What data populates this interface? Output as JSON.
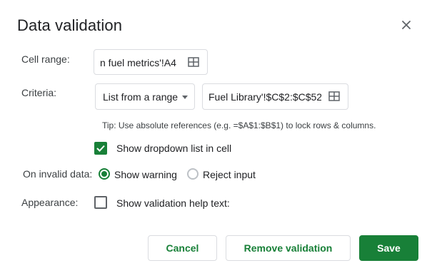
{
  "dialog": {
    "title": "Data validation",
    "close_icon": "close-icon"
  },
  "cell_range": {
    "label": "Cell range:",
    "value": "n fuel metrics'!A4",
    "icon": "grid-icon"
  },
  "criteria": {
    "label": "Criteria:",
    "dropdown_value": "List from a range",
    "range_value": "Fuel Library'!$C$2:$C$52",
    "icon": "grid-icon",
    "tip": "Tip: Use absolute references (e.g. =$A$1:$B$1) to lock rows & columns."
  },
  "show_dropdown": {
    "label": "Show dropdown list in cell",
    "checked": true
  },
  "invalid_data": {
    "label": "On invalid data:",
    "options": [
      {
        "label": "Show warning",
        "selected": true
      },
      {
        "label": "Reject input",
        "selected": false
      }
    ]
  },
  "appearance": {
    "label": "Appearance:",
    "help_text_label": "Show validation help text:",
    "checked": false
  },
  "buttons": {
    "cancel": "Cancel",
    "remove": "Remove validation",
    "save": "Save"
  },
  "colors": {
    "accent": "#188038",
    "border": "#dadce0",
    "text": "#202124"
  }
}
